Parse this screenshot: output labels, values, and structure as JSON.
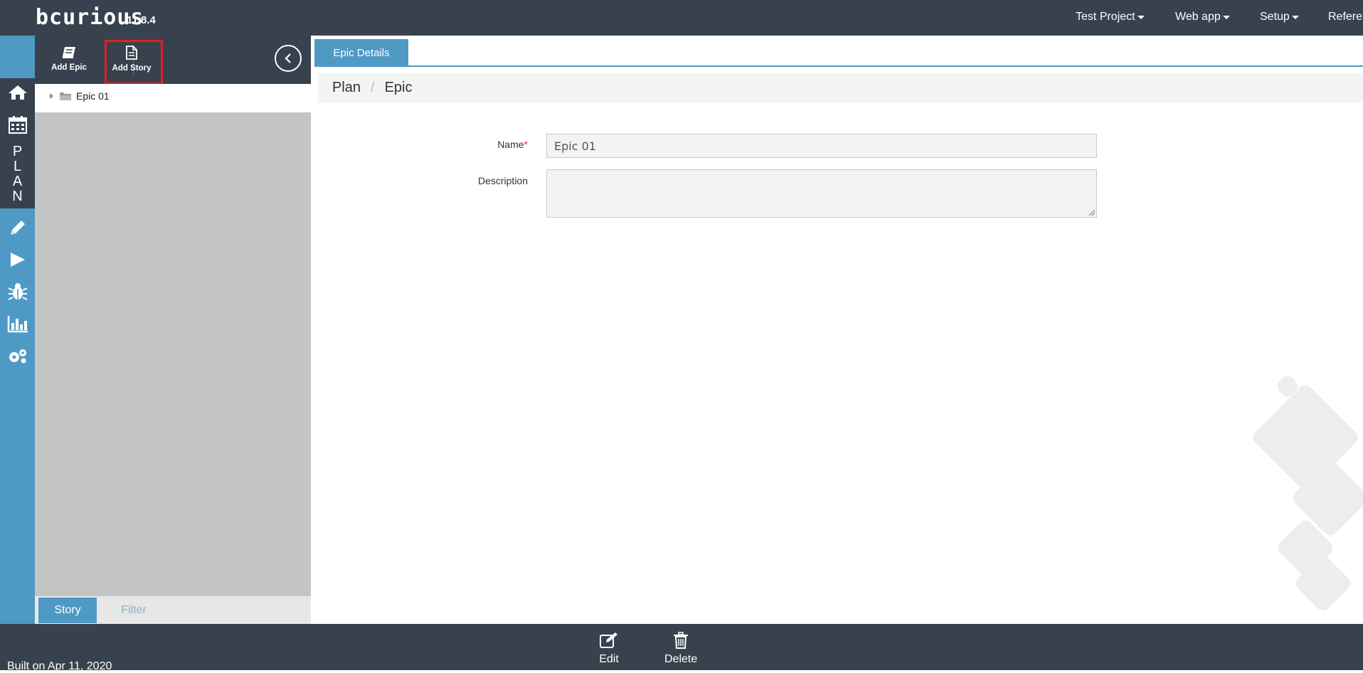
{
  "app": {
    "logo_text": "bcurious",
    "version": "11.8.4"
  },
  "topnav": [
    {
      "label": "Test Project"
    },
    {
      "label": "Web app"
    },
    {
      "label": "Setup"
    },
    {
      "label": "Refere"
    }
  ],
  "rail": {
    "plan_letters": [
      "P",
      "L",
      "A",
      "N"
    ],
    "icons": [
      "home-icon",
      "calendar-icon",
      "pencil-icon",
      "play-icon",
      "bug-icon",
      "bar-chart-icon",
      "gears-icon"
    ]
  },
  "toolbar": {
    "add_epic_label": "Add Epic",
    "add_story_label": "Add Story"
  },
  "tree": {
    "items": [
      {
        "label": "Epic 01"
      }
    ]
  },
  "panel_tabs": {
    "story": "Story",
    "filter": "Filter"
  },
  "main": {
    "tab_label": "Epic Details",
    "breadcrumb": [
      "Plan",
      "Epic"
    ],
    "form": {
      "name_label": "Name",
      "name_required_mark": "*",
      "name_value": "Epic 01",
      "description_label": "Description",
      "description_value": ""
    }
  },
  "footer": {
    "built_text": "Built on Apr 11, 2020",
    "edit_label": "Edit",
    "delete_label": "Delete"
  },
  "colors": {
    "dark": "#38424e",
    "accent": "#4e9ac4",
    "panel_gray": "#c3c4c4",
    "highlight_red": "#e0201f"
  }
}
